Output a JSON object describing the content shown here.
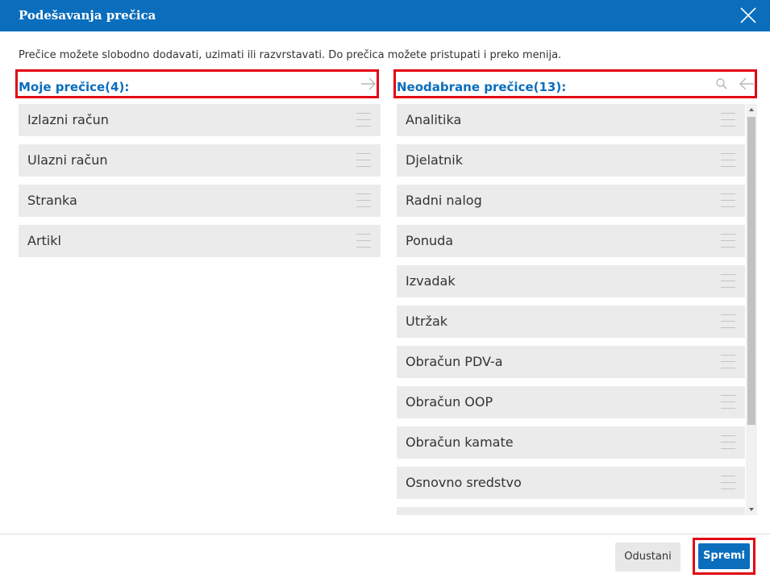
{
  "dialog": {
    "title": "Podešavanja prečica"
  },
  "intro_text": "Prečice možete slobodno dodavati, uzimati ili razvrstavati. Do prečica možete pristupati i preko menija.",
  "selected": {
    "title": "Moje prečice(4):",
    "items": [
      "Izlazni račun",
      "Ulazni račun",
      "Stranka",
      "Artikl"
    ]
  },
  "unselected": {
    "title": "Neodabrane prečice(13):",
    "items": [
      "Analitika",
      "Djelatnik",
      "Radni nalog",
      "Ponuda",
      "Izvadak",
      "Utržak",
      "Obračun PDV-a",
      "Obračun OOP",
      "Obračun kamate",
      "Osnovno sredstvo",
      ""
    ]
  },
  "buttons": {
    "cancel": "Odustani",
    "save": "Spremi"
  },
  "colors": {
    "accent": "#0a6ebd",
    "highlight_border": "#e30613",
    "item_bg": "#ebebeb"
  },
  "icons": {
    "close": "close-icon",
    "arrow_right": "arrow-right-icon",
    "arrow_left": "arrow-left-icon",
    "search": "search-icon",
    "drag_handle": "drag-handle-icon"
  }
}
